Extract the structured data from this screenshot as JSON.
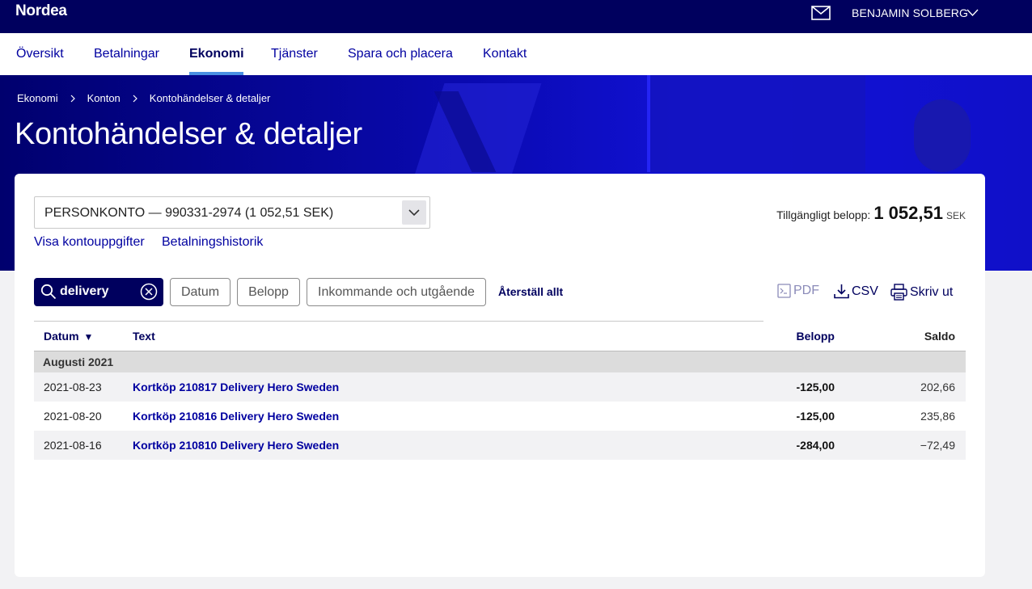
{
  "brand": {
    "logo": "Nordea",
    "user_name": "BENJAMIN SOLBERG"
  },
  "nav": {
    "items": [
      {
        "label": "Översikt"
      },
      {
        "label": "Betalningar"
      },
      {
        "label": "Ekonomi"
      },
      {
        "label": "Tjänster"
      },
      {
        "label": "Spara och placera"
      },
      {
        "label": "Kontakt"
      }
    ],
    "active": "Ekonomi"
  },
  "breadcrumb": [
    "Ekonomi",
    "Konton",
    "Kontohändelser & detaljer"
  ],
  "page_title": "Kontohändelser & detaljer",
  "account": {
    "selected": "PERSONKONTO — 990331-2974 (1 052,51 SEK)",
    "links": [
      "Visa kontouppgifter",
      "Betalningshistorik"
    ],
    "available_label": "Tillgängligt belopp:",
    "available_int": "1 052",
    "available_dec": ",51",
    "currency": "SEK"
  },
  "filters": {
    "search_value": "delivery",
    "buttons": [
      "Datum",
      "Belopp",
      "Inkommande och utgående"
    ],
    "reset": "Återställ allt"
  },
  "export": {
    "pdf": "PDF",
    "csv": "CSV",
    "print": "Skriv ut"
  },
  "table": {
    "headers": {
      "date": "Datum",
      "sort_indicator": "▼",
      "text": "Text",
      "amount": "Belopp",
      "balance": "Saldo"
    },
    "group": "Augusti 2021",
    "rows": [
      {
        "date": "2021-08-23",
        "text": "Kortköp 210817 Delivery Hero Sweden",
        "amount": "-125,00",
        "balance": "202,66"
      },
      {
        "date": "2021-08-20",
        "text": "Kortköp 210816 Delivery Hero Sweden",
        "amount": "-125,00",
        "balance": "235,86"
      },
      {
        "date": "2021-08-16",
        "text": "Kortköp 210810 Delivery Hero Sweden",
        "amount": "-284,00",
        "balance": "−72,49"
      }
    ]
  },
  "colors": {
    "brand_navy": "#00005e",
    "link_blue": "#0000a0",
    "accent_underline": "#4a90e2"
  }
}
